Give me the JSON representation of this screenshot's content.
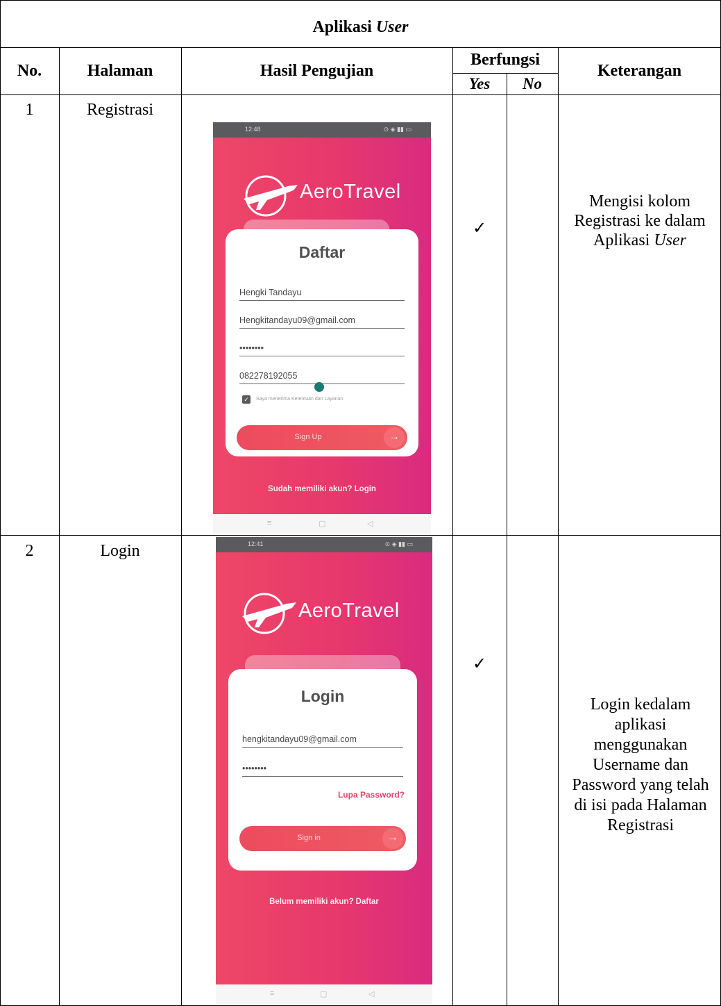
{
  "table": {
    "section_title_bold": "Aplikasi",
    "section_title_italic": "User",
    "headers": {
      "no": "No.",
      "page": "Halaman",
      "result": "Hasil Pengujian",
      "works": "Berfungsi",
      "yes": "Yes",
      "no_col": "No",
      "note": "Keterangan"
    },
    "rows": [
      {
        "no": "1",
        "page": "Registrasi",
        "yes": "✓",
        "no_col": "",
        "note_text": "Mengisi kolom Registrasi ke dalam Aplikasi",
        "note_italic": "User"
      },
      {
        "no": "2",
        "page": "Login",
        "yes": "✓",
        "no_col": "",
        "note_text": "Login kedalam aplikasi menggunakan Username dan Password yang telah di isi pada Halaman Registrasi",
        "note_italic": ""
      }
    ]
  },
  "phones": {
    "register": {
      "status_time": "12:48",
      "app_name": "AeroTravel",
      "title": "Daftar",
      "name_value": "Hengki Tandayu",
      "email_value": "Hengkitandayu09@gmail.com",
      "password_value": "••••••••",
      "phone_value": "082278192055",
      "terms_label": "Saya menerima Ketentuan dan Layanan",
      "button_label": "Sign Up",
      "bottom_link": "Sudah memiliki akun? Login"
    },
    "login": {
      "status_time": "12:41",
      "app_name": "AeroTravel",
      "title": "Login",
      "email_value": "hengkitandayu09@gmail.com",
      "password_value": "••••••••",
      "forgot_label": "Lupa Password?",
      "button_label": "Sign in",
      "bottom_link": "Belum memiliki akun? Daftar"
    }
  },
  "colors": {
    "gradient_start": "#ee4767",
    "gradient_end": "#d92b80",
    "accent": "#e2456a"
  }
}
